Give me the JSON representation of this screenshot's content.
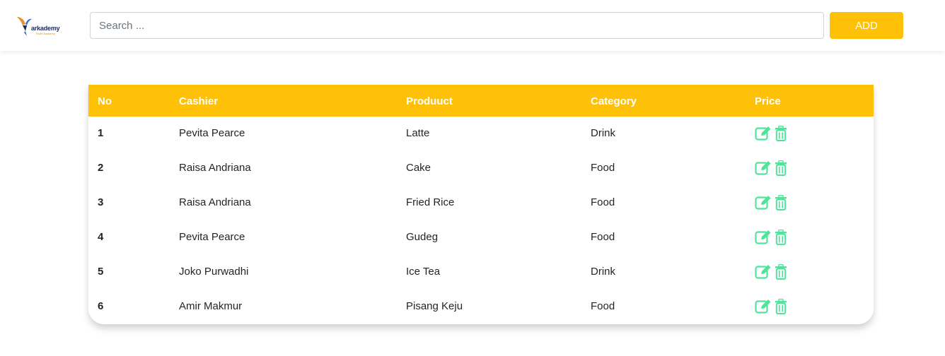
{
  "header": {
    "logo_text": "arkademy",
    "logo_subtext": "Trade Academy",
    "search_placeholder": "Search ...",
    "add_label": "ADD"
  },
  "table": {
    "columns": [
      "No",
      "Cashier",
      "Produuct",
      "Category",
      "Price"
    ],
    "rows": [
      {
        "no": "1",
        "cashier": "Pevita Pearce",
        "product": "Latte",
        "category": "Drink"
      },
      {
        "no": "2",
        "cashier": "Raisa Andriana",
        "product": "Cake",
        "category": "Food"
      },
      {
        "no": "3",
        "cashier": "Raisa Andriana",
        "product": "Fried Rice",
        "category": "Food"
      },
      {
        "no": "4",
        "cashier": "Pevita Pearce",
        "product": "Gudeg",
        "category": "Food"
      },
      {
        "no": "5",
        "cashier": "Joko Purwadhi",
        "product": "Ice Tea",
        "category": "Drink"
      },
      {
        "no": "6",
        "cashier": "Amir Makmur",
        "product": "Pisang Keju",
        "category": "Food"
      }
    ],
    "row_actions": [
      "edit-icon",
      "trash-icon"
    ]
  },
  "colors": {
    "accent": "#ffc107",
    "action_icon": "#4ee49a",
    "header_text": "#ffffff"
  }
}
